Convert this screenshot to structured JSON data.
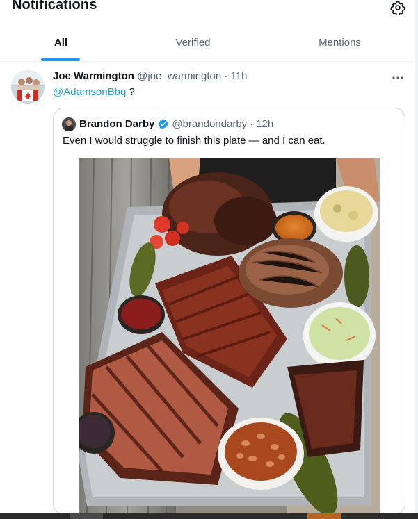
{
  "page": {
    "title": "Notifications",
    "settings_icon": "gear-icon"
  },
  "tabs": [
    {
      "label": "All",
      "active": true
    },
    {
      "label": "Verified",
      "active": false
    },
    {
      "label": "Mentions",
      "active": false
    }
  ],
  "tweet": {
    "author_name": "Joe Warmington",
    "handle": "@joe_warmington",
    "separator": "·",
    "time": "11h",
    "more_icon": "more-horizontal-icon",
    "mention": "@AdamsonBbq",
    "text_suffix": " ?",
    "quote": {
      "author_name": "Brandon Darby",
      "verified": true,
      "handle": "@brandondarby",
      "separator": "·",
      "time": "12h",
      "text": "Even I would struggle to finish this plate — and I can eat."
    }
  },
  "colors": {
    "accent": "#1d9bf0",
    "text": "#0f1419",
    "muted": "#536471",
    "border": "#cfd9de"
  }
}
